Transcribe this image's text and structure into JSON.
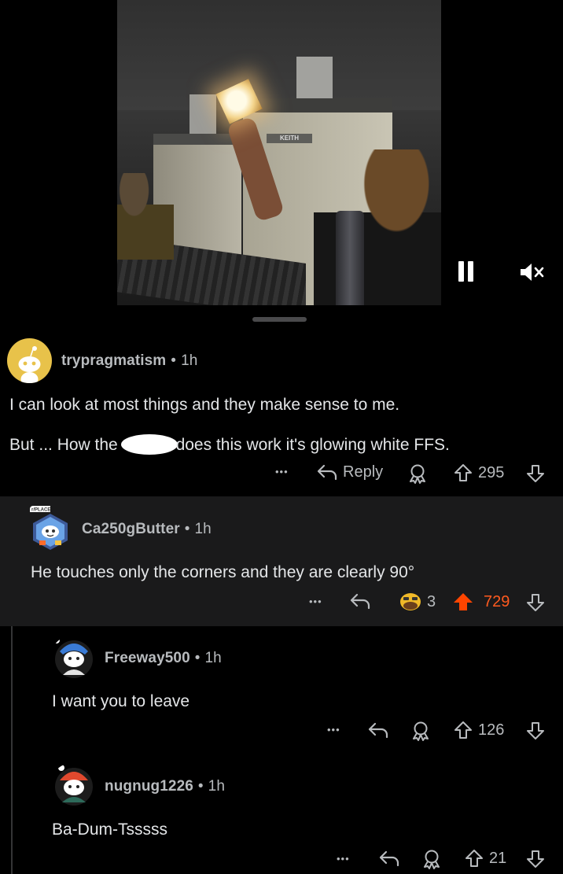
{
  "video": {
    "label_text": "KEITH",
    "controls": {
      "pause_icon": "pause-icon",
      "mute_icon": "mute-icon"
    }
  },
  "comments": [
    {
      "username": "trypragmatism",
      "age": "1h",
      "lines": [
        "I can look at most things and they make sense to me.",
        "But ... How the",
        "does this work it's glowing white FFS."
      ],
      "reply_label": "Reply",
      "votes": "295"
    },
    {
      "username": "Ca250gButter",
      "avatar_badge": "r/PLACE",
      "age": "1h",
      "text": "He touches only the corners and they are clearly 90°",
      "award_count": "3",
      "votes": "729",
      "vote_color": "#ff5a1f",
      "upvote_color": "#ff4500"
    },
    {
      "username": "Freeway500",
      "age": "1h",
      "text": "I want you to leave",
      "votes": "126"
    },
    {
      "username": "nugnug1226",
      "age": "1h",
      "text": "Ba-Dum-Tsssss",
      "votes": "21"
    }
  ],
  "separator": "•",
  "more_label": "•••"
}
